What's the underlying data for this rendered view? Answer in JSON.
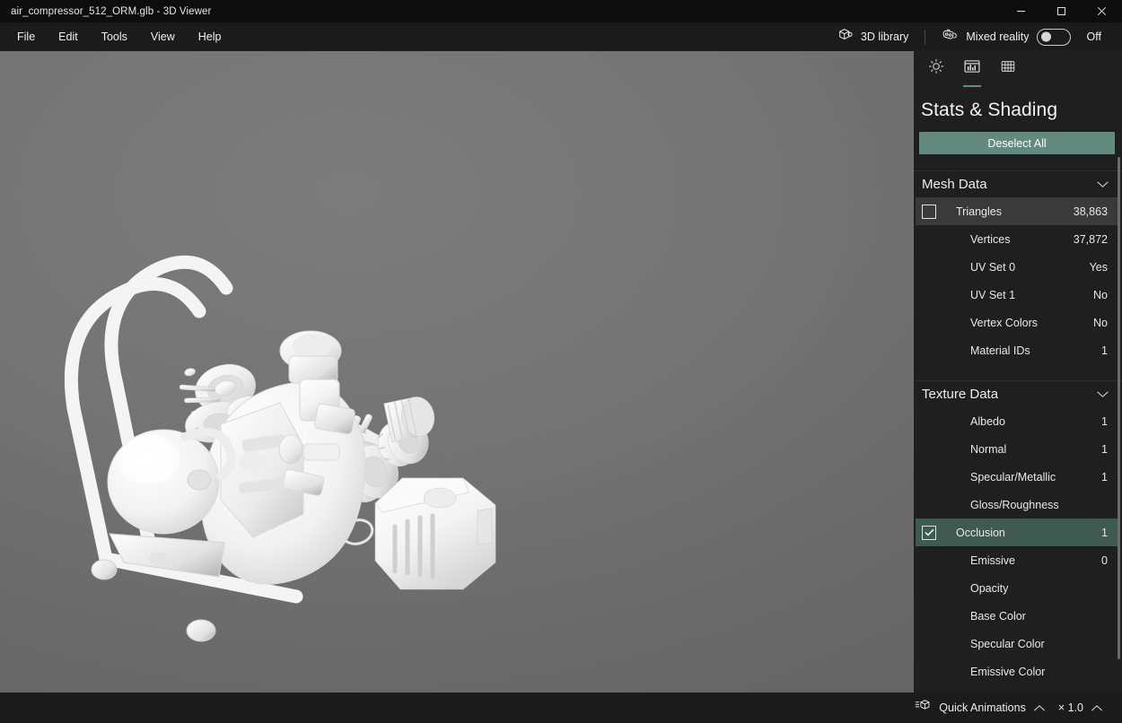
{
  "window": {
    "title": "air_compressor_512_ORM.glb - 3D Viewer",
    "minimize_label": "Minimize",
    "maximize_label": "Maximize",
    "close_label": "Close"
  },
  "menubar": {
    "items": [
      {
        "label": "File"
      },
      {
        "label": "Edit"
      },
      {
        "label": "Tools"
      },
      {
        "label": "View"
      },
      {
        "label": "Help"
      }
    ],
    "library_label": "3D library",
    "mixed_reality_label": "Mixed reality",
    "mixed_reality_state": "Off"
  },
  "panel": {
    "tabs": [
      {
        "name": "lighting",
        "icon": "sun-icon",
        "active": false
      },
      {
        "name": "stats-shading",
        "icon": "stats-icon",
        "active": true
      },
      {
        "name": "grid",
        "icon": "grid-icon",
        "active": false
      }
    ],
    "title": "Stats & Shading",
    "deselect_label": "Deselect All",
    "accent_color": "#628a7e",
    "selected_row_color": "#3e5a51",
    "sections": [
      {
        "title": "Mesh Data",
        "rows": [
          {
            "label": "Triangles",
            "value": "38,863",
            "state": "hovered"
          },
          {
            "label": "Vertices",
            "value": "37,872",
            "state": "normal"
          },
          {
            "label": "UV Set 0",
            "value": "Yes",
            "state": "normal"
          },
          {
            "label": "UV Set 1",
            "value": "No",
            "state": "normal"
          },
          {
            "label": "Vertex Colors",
            "value": "No",
            "state": "normal"
          },
          {
            "label": "Material IDs",
            "value": "1",
            "state": "normal"
          }
        ]
      },
      {
        "title": "Texture Data",
        "rows": [
          {
            "label": "Albedo",
            "value": "1",
            "state": "normal"
          },
          {
            "label": "Normal",
            "value": "1",
            "state": "normal"
          },
          {
            "label": "Specular/Metallic",
            "value": "1",
            "state": "normal"
          },
          {
            "label": "Gloss/Roughness",
            "value": "",
            "state": "normal"
          },
          {
            "label": "Occlusion",
            "value": "1",
            "state": "selected"
          },
          {
            "label": "Emissive",
            "value": "0",
            "state": "normal"
          },
          {
            "label": "Opacity",
            "value": "",
            "state": "normal"
          },
          {
            "label": "Base Color",
            "value": "",
            "state": "normal"
          },
          {
            "label": "Specular Color",
            "value": "",
            "state": "normal"
          },
          {
            "label": "Emissive Color",
            "value": "",
            "state": "normal"
          }
        ]
      }
    ]
  },
  "statusbar": {
    "quick_animations_label": "Quick Animations",
    "speed_label": "× 1.0"
  },
  "viewport": {
    "model_description": "Exploded view of an air compressor, untextured white shaded model on gray gradient background"
  }
}
